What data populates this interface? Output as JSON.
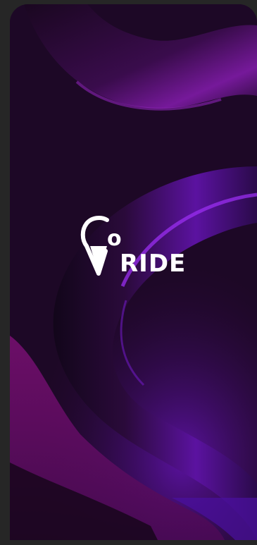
{
  "app": {
    "logo_letter_o": "o",
    "logo_word": "RIDE",
    "logo_full": "GoRIDE"
  },
  "colors": {
    "page_background": "#262626",
    "screen_dark": "#1c0826",
    "accent_purple": "#8a1fd6",
    "accent_magenta": "#a0138f",
    "logo_white": "#ffffff"
  },
  "icons": {
    "logo_mark": "map-pin-g-icon"
  }
}
